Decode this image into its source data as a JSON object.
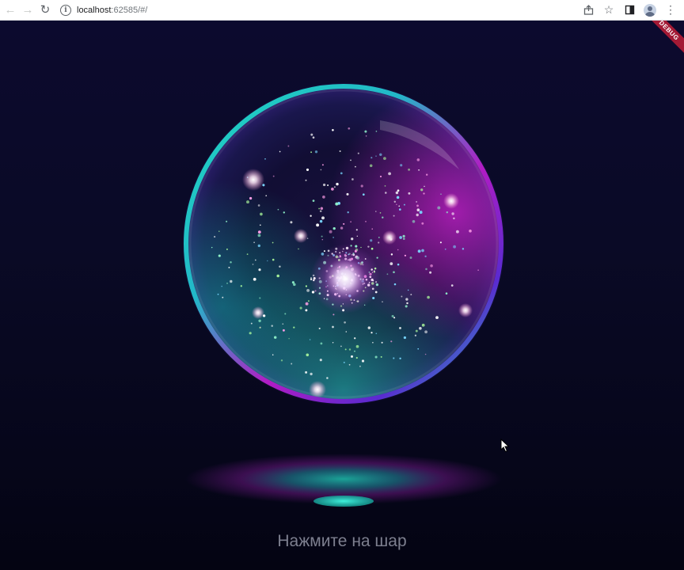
{
  "browser": {
    "url_host": "localhost",
    "url_rest": ":62585/#/",
    "back_icon": "arrow-left-icon",
    "forward_icon": "arrow-right-icon",
    "reload_icon": "reload-icon",
    "info_icon": "info-icon",
    "share_icon": "share-icon",
    "bookmark_icon": "star-icon",
    "sidepanel_icon": "side-panel-icon",
    "profile_icon": "profile-avatar-icon",
    "menu_icon": "more-vertical-icon"
  },
  "app": {
    "debug_banner": "DEBUG",
    "prompt": "Нажмите на шар",
    "orb_icon": "crystal-ball-icon",
    "colors": {
      "background": "#0a0a26",
      "rim_teal": "#1fd6c0",
      "rim_magenta": "#c020c8",
      "prompt_text": "#7d7f8f",
      "debug_banner": "#a31a35"
    }
  }
}
